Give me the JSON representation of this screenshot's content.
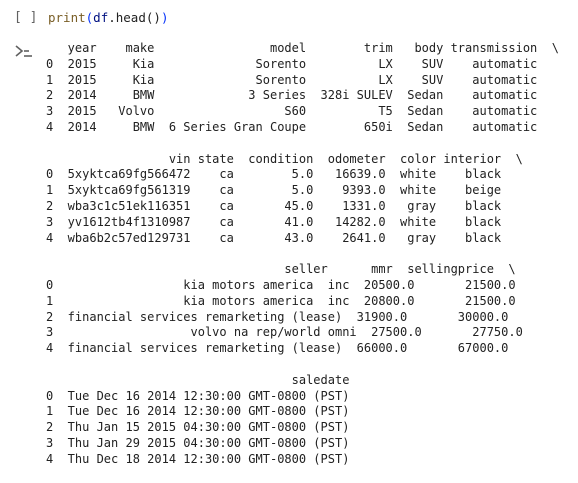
{
  "cell": {
    "run_indicator": "[ ]",
    "code": {
      "fn": "print",
      "open": "(",
      "obj": "df",
      "method": ".head",
      "call": "()",
      "close": ")"
    }
  },
  "output": {
    "icon": "output-arrow-icon",
    "block1": [
      "   year    make                model        trim   body transmission  \\",
      "0  2015     Kia              Sorento          LX    SUV    automatic   ",
      "1  2015     Kia              Sorento          LX    SUV    automatic   ",
      "2  2014     BMW             3 Series  328i SULEV  Sedan    automatic   ",
      "3  2015   Volvo                  S60          T5  Sedan    automatic   ",
      "4  2014     BMW  6 Series Gran Coupe        650i  Sedan    automatic   "
    ],
    "block2": [
      "                 vin state  condition  odometer  color interior  \\",
      "0  5xyktca69fg566472    ca        5.0   16639.0  white    black   ",
      "1  5xyktca69fg561319    ca        5.0    9393.0  white    beige   ",
      "2  wba3c1c51ek116351    ca       45.0    1331.0   gray    black   ",
      "3  yv1612tb4f1310987    ca       41.0   14282.0  white    black   ",
      "4  wba6b2c57ed129731    ca       43.0    2641.0   gray    black   "
    ],
    "block3": [
      "                                 seller      mmr  sellingprice  \\",
      "0                  kia motors america  inc  20500.0       21500.0   ",
      "1                  kia motors america  inc  20800.0       21500.0   ",
      "2  financial services remarketing (lease)  31900.0       30000.0   ",
      "3                   volvo na rep/world omni  27500.0       27750.0   ",
      "4  financial services remarketing (lease)  66000.0       67000.0   "
    ],
    "block4": [
      "                                  saledate",
      "0  Tue Dec 16 2014 12:30:00 GMT-0800 (PST)",
      "1  Tue Dec 16 2014 12:30:00 GMT-0800 (PST)",
      "2  Thu Jan 15 2015 04:30:00 GMT-0800 (PST)",
      "3  Thu Jan 29 2015 04:30:00 GMT-0800 (PST)",
      "4  Thu Dec 18 2014 12:30:00 GMT-0800 (PST)"
    ]
  }
}
